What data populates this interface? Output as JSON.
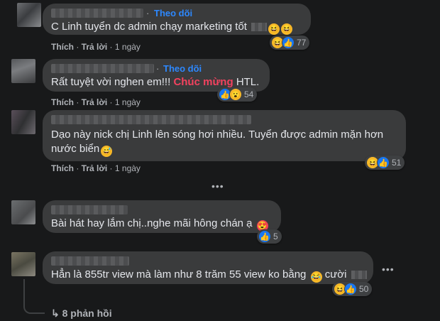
{
  "labels": {
    "follow": "Theo dõi",
    "like": "Thích",
    "reply": "Trả lời",
    "sep": "·",
    "more": "•••",
    "replies": "↳ 8 phản hồi"
  },
  "comments": [
    {
      "text": "C Linh tuyển dc admin chạy marketing tốt",
      "time": "1 ngày",
      "reactions": [
        "haha-icon",
        "like-icon"
      ],
      "count": "77"
    },
    {
      "text_pre": "Rất tuyệt vời nghen em!!!",
      "text_highlight": "Chúc mừng",
      "text_post": "HTL.",
      "time": "1 ngày",
      "reactions": [
        "like-icon",
        "wow-icon"
      ],
      "count": "54"
    },
    {
      "text_line1": "Dạo này nick chị Linh lên sóng hơi nhiều. Tuyển được admin mặn hơn",
      "text_line2": "nước biển",
      "time": "1 ngày",
      "reactions": [
        "haha-icon",
        "like-icon"
      ],
      "count": "51"
    },
    {
      "text": "Bài hát hay lắm chị..nghe mãi hông chán ạ",
      "reactions": [
        "like-icon"
      ],
      "count": "5"
    },
    {
      "text": "Hẳn là 855tr view mà làm như 8 trăm 55 view ko bằng",
      "text_tail": "cười",
      "reactions": [
        "haha-icon",
        "like-icon"
      ],
      "count": "50"
    }
  ],
  "colors": {
    "background": "#18191a",
    "bubble": "#3a3b3c",
    "link": "#2d88ff",
    "highlight": "#f3425f",
    "text": "#e4e6eb",
    "meta": "#b0b3b8"
  }
}
